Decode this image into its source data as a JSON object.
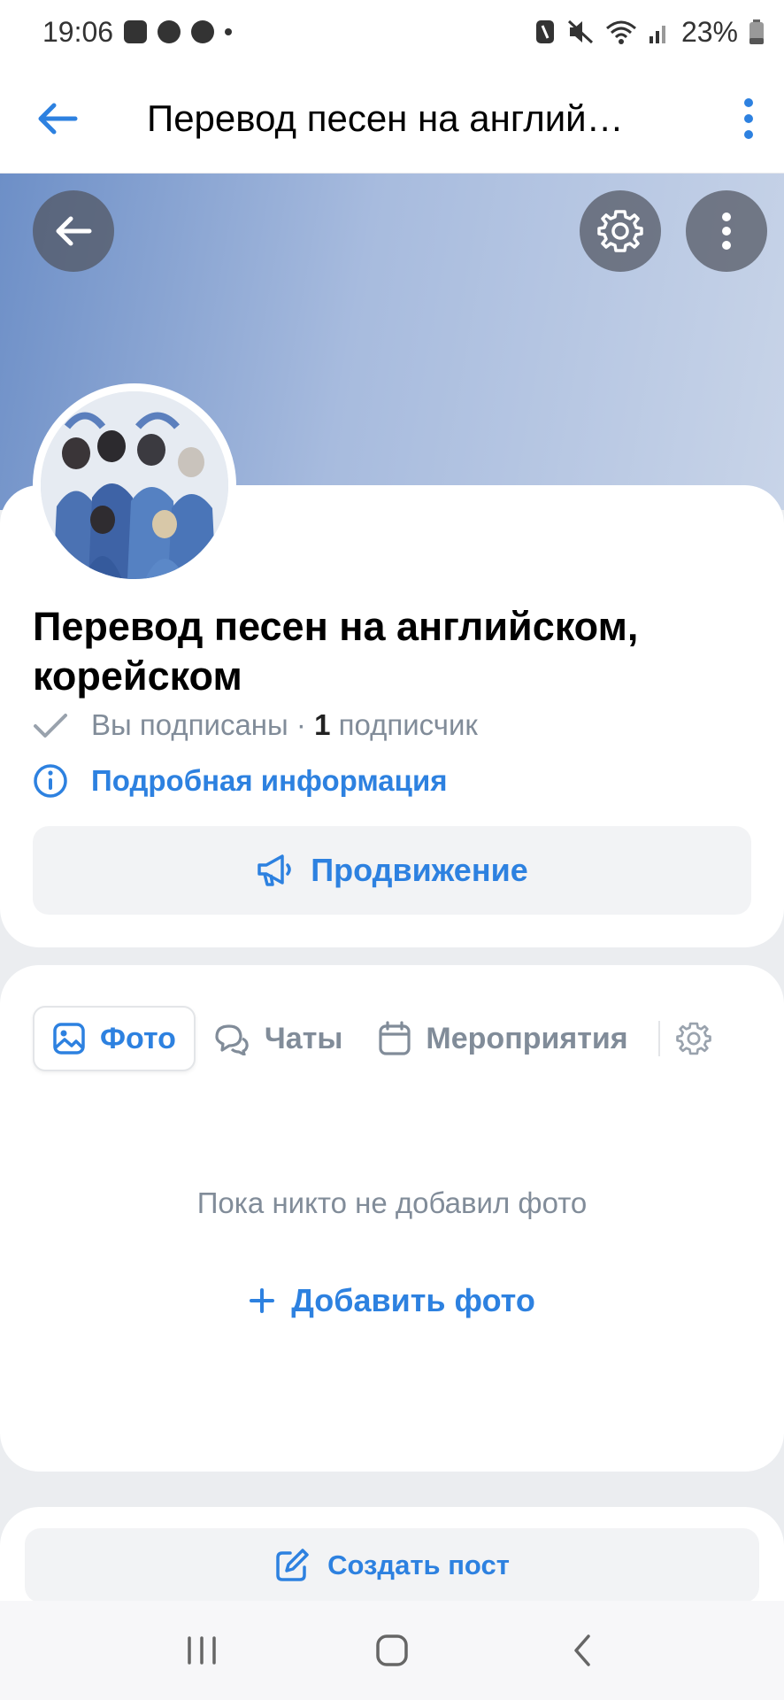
{
  "status_bar": {
    "time": "19:06",
    "battery": "23%"
  },
  "app_bar": {
    "title": "Перевод песен на англий…"
  },
  "group": {
    "name": "Перевод песен на английском, корейском",
    "subscribed_label": "Вы подписаны",
    "separator": " · ",
    "subscriber_count": "1",
    "subscriber_word": "подписчик",
    "info_link": "Подробная информация",
    "promo_button": "Продвижение"
  },
  "tabs": [
    {
      "label": "Фото",
      "icon": "image-icon",
      "active": true
    },
    {
      "label": "Чаты",
      "icon": "chat-icon",
      "active": false
    },
    {
      "label": "Мероприятия",
      "icon": "calendar-icon",
      "active": false
    }
  ],
  "empty_state": {
    "text": "Пока никто не добавил фото",
    "action": "Добавить фото"
  },
  "post": {
    "button": "Создать пост"
  },
  "colors": {
    "accent": "#2d81e0",
    "secondary_text": "#818c99",
    "background": "#ebedf0"
  }
}
